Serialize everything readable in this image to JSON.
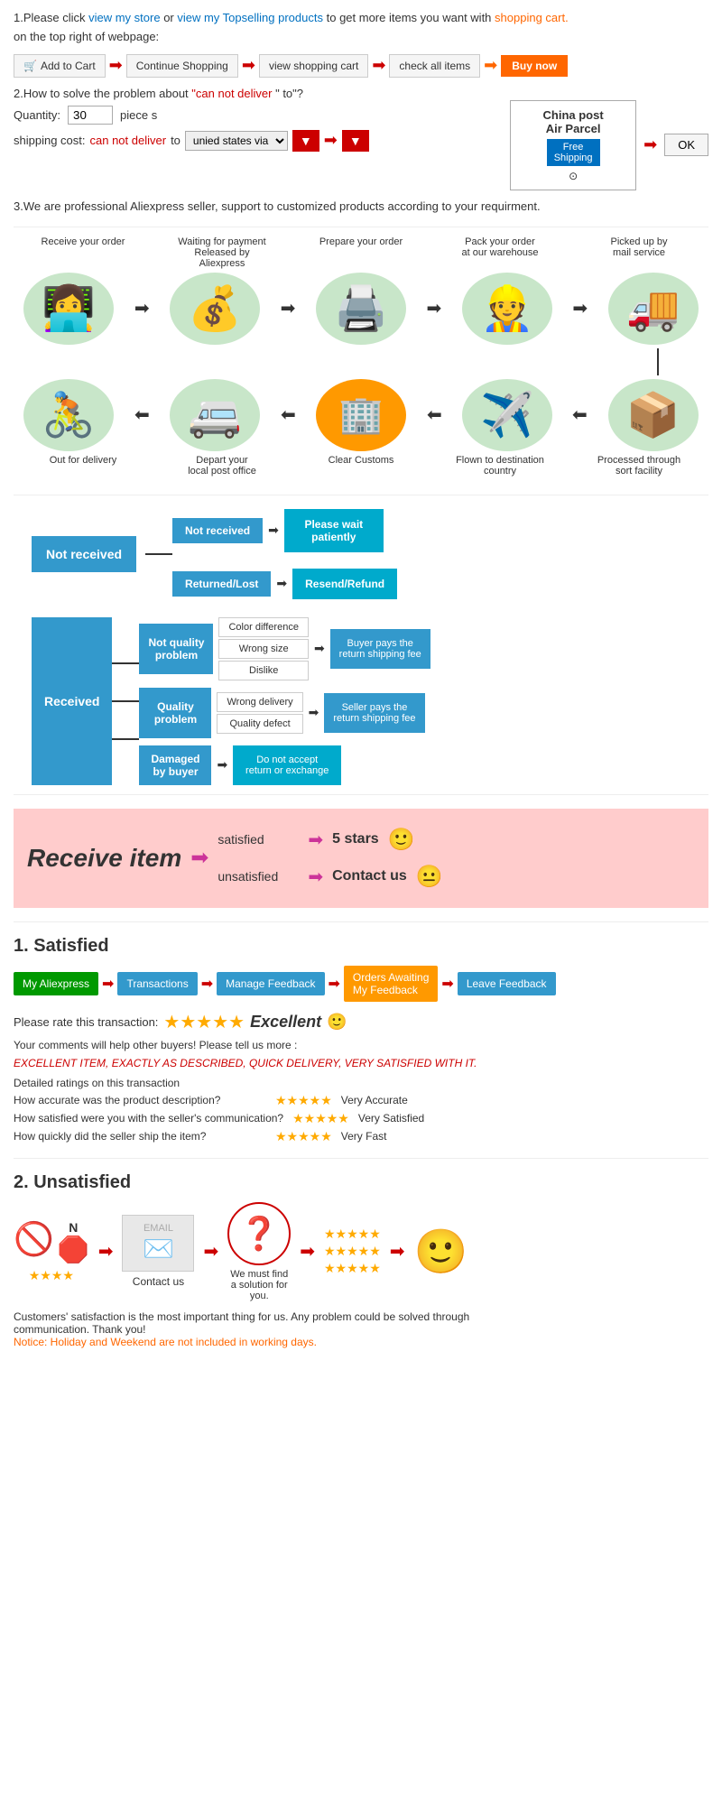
{
  "page": {
    "section1": {
      "text1": "1.Please click ",
      "link1": "view my store",
      "text2": "or ",
      "link2": "view my Topselling products",
      "text3": " to get more items you want with",
      "link3": "shopping cart.",
      "text4": "on the top right of webpage:",
      "cart_steps": [
        {
          "label": "Add to Cart",
          "icon": "🛒"
        },
        {
          "label": "Continue Shopping"
        },
        {
          "label": "view shopping cart"
        },
        {
          "label": "check all items"
        },
        {
          "label": "Buy now",
          "special": "buy"
        }
      ]
    },
    "section2": {
      "title": "2.How to solve the problem about",
      "red_text": "can not deliver",
      "title2": " to?",
      "quantity_label": "Quantity:",
      "quantity_value": "30",
      "piece_text": "piece s",
      "shipping_label": "shipping cost:",
      "shipping_red": "can not deliver",
      "shipping_to": " to ",
      "shipping_select": "unied states via",
      "china_post_title": "China post",
      "air_parcel": "Air Parcel",
      "free_shipping": "Free Shipping",
      "free_icon": "⊙",
      "ok_btn": "OK"
    },
    "section3": {
      "text": "3.We are professional Aliexpress seller, support to customized products according to your requirment."
    },
    "process": {
      "row1_labels": [
        "Receive your order",
        "Waiting for payment\nReleased by Aliexpress",
        "Prepare your order",
        "Pack your order\nat our warehouse",
        "Picked up by\nmail service"
      ],
      "row1_icons": [
        "👩‍💻",
        "💰",
        "🖨️",
        "👷",
        "🚚"
      ],
      "row2_labels": [
        "Out for delivery",
        "Depart your\nlocal post office",
        "Clear Customs",
        "Flown to destination\ncountry",
        "Processed through\nsort facility"
      ],
      "row2_icons": [
        "🚴",
        "🚐",
        "🏢",
        "✈️",
        "📦"
      ]
    },
    "not_received": {
      "main_label": "Not received",
      "branch1": "Not received",
      "result1": "Please wait\npatiently",
      "branch2": "Returned/Lost",
      "result2": "Resend/Refund"
    },
    "received": {
      "main_label": "Received",
      "branch1_label": "Not quality\nproblem",
      "branch1_items": [
        "Color difference",
        "Wrong size",
        "Dislike"
      ],
      "branch1_result": "Buyer pays the\nreturn shipping fee",
      "branch2_label": "Quality\nproblem",
      "branch2_items": [
        "Wrong delivery",
        "Quality defect"
      ],
      "branch2_result": "Seller pays the\nreturn shipping fee",
      "branch3_label": "Damaged\nby buyer",
      "branch3_result": "Do not accept\nreturn or exchange"
    },
    "pink_section": {
      "receive_item": "Receive item",
      "row1_label": "satisfied",
      "row1_result": "5 stars",
      "smiley1": "🙂",
      "row2_label": "unsatisfied",
      "row2_result": "Contact us",
      "smiley2": "😐"
    },
    "satisfied": {
      "title": "1. Satisfied",
      "steps": [
        "My Aliexpress",
        "Transactions",
        "Manage Feedback",
        "Orders Awaiting\nMy Feedback",
        "Leave Feedback"
      ],
      "rate_text": "Please rate this transaction:",
      "excellent_text": "Excellent",
      "smiley": "🙂",
      "comments_text": "Your comments will help other buyers! Please tell us more :",
      "banner_text": "EXCELLENT ITEM, EXACTLY AS DESCRIBED, QUICK DELIVERY, VERY SATISFIED WITH IT.",
      "ratings_title": "Detailed ratings on this transaction",
      "ratings": [
        {
          "label": "How accurate was the product description?",
          "stars": "★★★★★",
          "value": "Very Accurate"
        },
        {
          "label": "How satisfied were you with the seller's communication?",
          "stars": "★★★★★",
          "value": "Very Satisfied"
        },
        {
          "label": "How quickly did the seller ship the item?",
          "stars": "★★★★★",
          "value": "Very Fast"
        }
      ]
    },
    "unsatisfied": {
      "title": "2. Unsatisfied",
      "icon1": "🚫",
      "icon2": "🛑",
      "icon3": "✉️",
      "icon4": "❓",
      "icon5": "🙂",
      "stars_row1": "★★★★★",
      "stars_row2": "★★★★★",
      "stars_row3": "★★★★★",
      "contact_label": "Contact us",
      "solution_label": "We must find\na solution for\nyou.",
      "notice1": "Customers' satisfaction is the most important thing for us. Any problem could be solved through\ncommunication. Thank you!",
      "notice2": "Notice: Holiday and Weekend are not included in working days."
    }
  }
}
